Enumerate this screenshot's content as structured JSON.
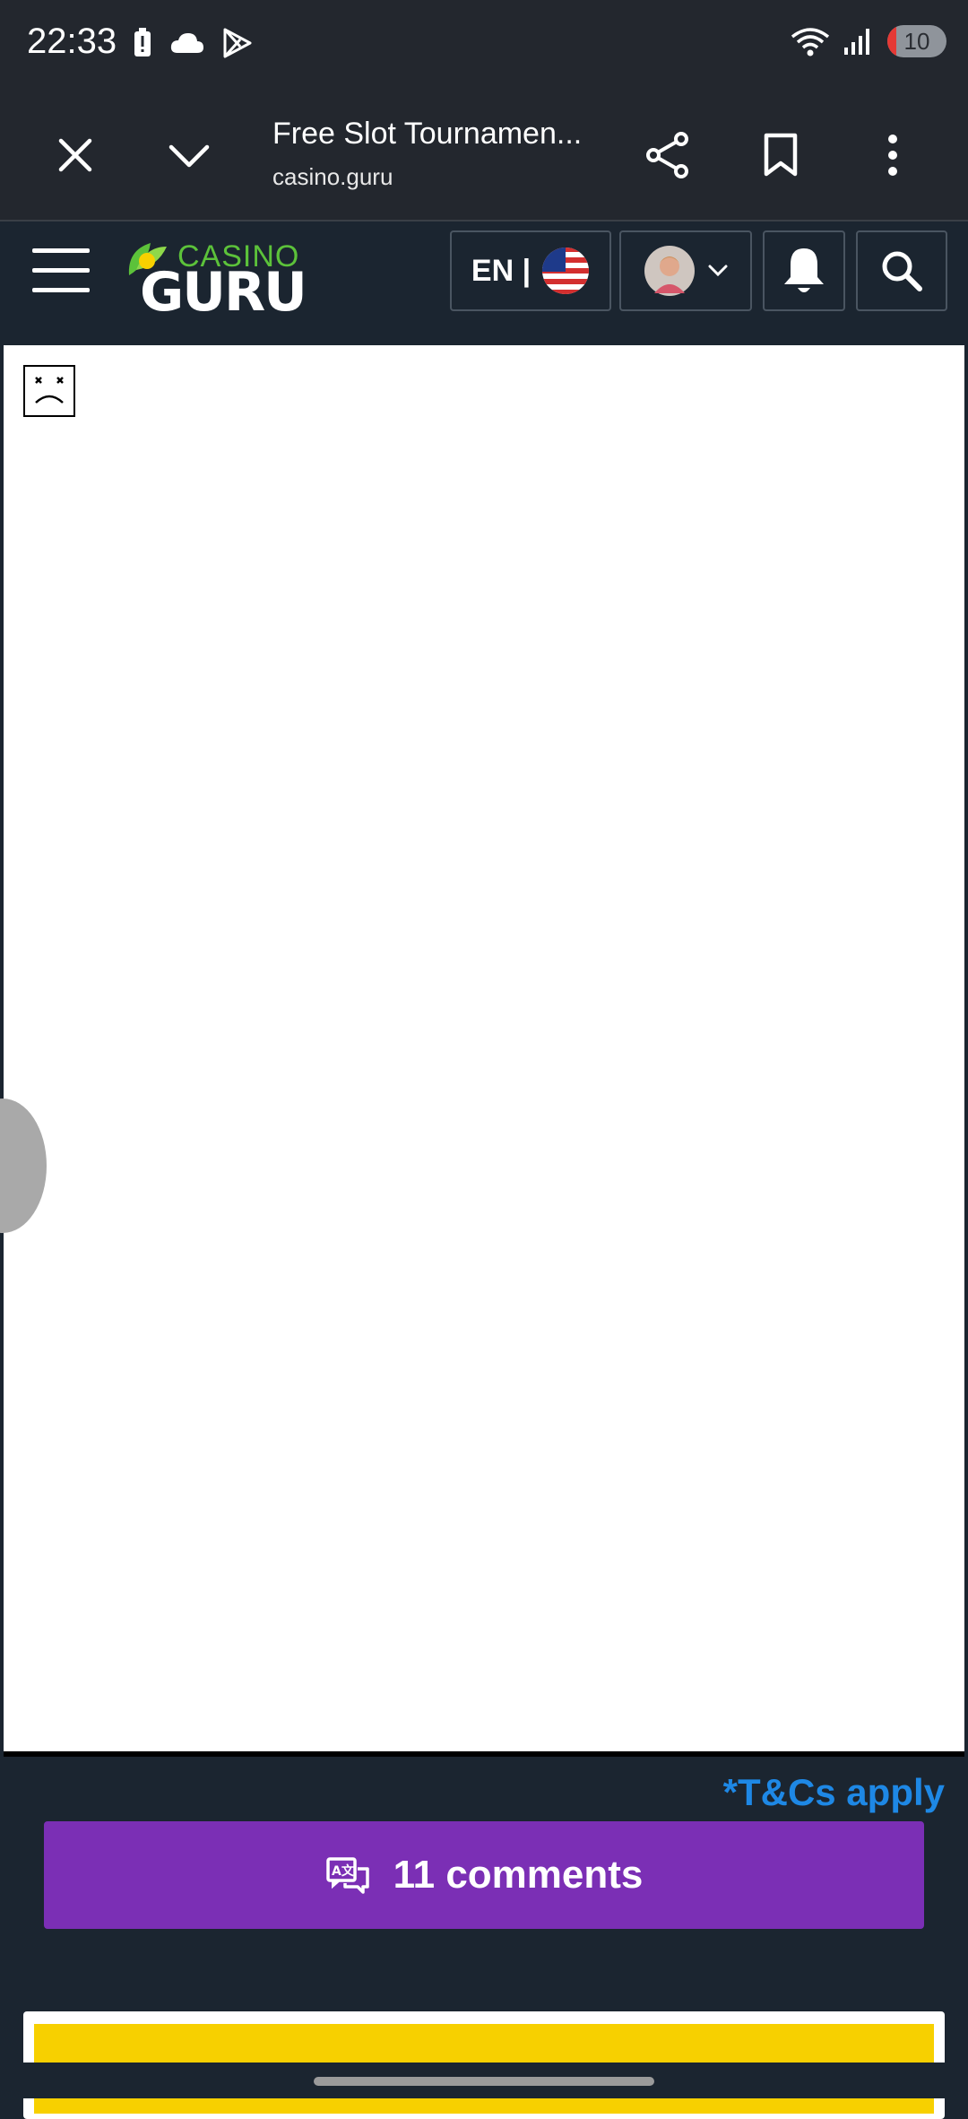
{
  "status_bar": {
    "time": "22:33",
    "icons_left": [
      "battery-alert-icon",
      "cloud-icon",
      "play-store-icon"
    ],
    "icons_right": [
      "wifi-icon",
      "signal-icon",
      "battery-icon"
    ],
    "battery_level": "10"
  },
  "browser": {
    "title": "Free Slot Tournamen...",
    "url": "casino.guru",
    "buttons": [
      "close-icon",
      "chevron-down-icon",
      "share-icon",
      "bookmark-icon",
      "more-vert-icon"
    ]
  },
  "header": {
    "logo_casino": "CASINO",
    "logo_guru": "GURU",
    "language": "EN |",
    "flag": "us-flag-icon",
    "accent_color": "#5cc23a"
  },
  "content": {
    "broken_image": "broken-image-icon"
  },
  "footer": {
    "tcs_label": "*T&Cs apply",
    "comments_label": "11 comments",
    "comments_color": "#7b2fb5",
    "tcs_color": "#1e88e5"
  }
}
